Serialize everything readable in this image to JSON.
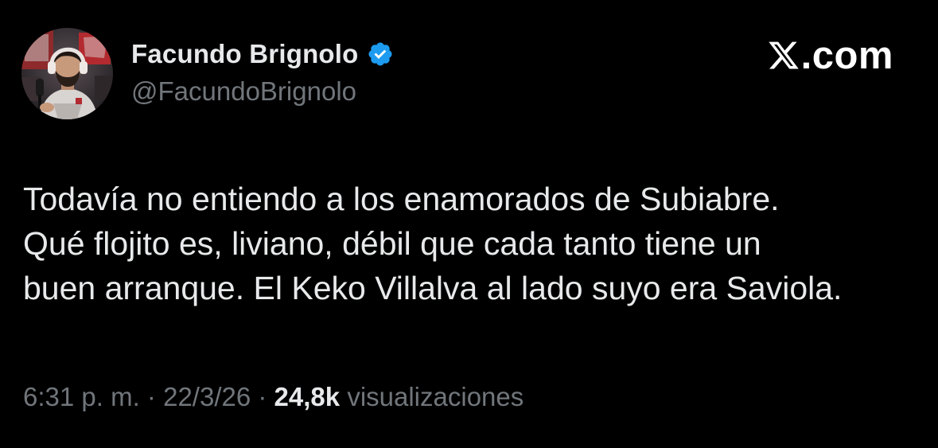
{
  "tweet": {
    "author": {
      "display_name": "Facundo Brignolo",
      "handle": "@FacundoBrignolo",
      "verified": true,
      "verified_color": "#1d9bf0"
    },
    "brand": {
      "text": ".com",
      "logo": "x-logo-icon"
    },
    "body_lines": [
      "Todavía no entiendo a los enamorados de Subiabre.",
      "Qué flojito es, liviano, débil que cada tanto tiene un",
      "buen arranque. El Keko Villalva al lado suyo era Saviola."
    ],
    "meta": {
      "time": "6:31 p. m.",
      "separator": "·",
      "date": "22/3/26",
      "views_count": "24,8k",
      "views_label": "visualizaciones"
    }
  },
  "colors": {
    "background": "#000000",
    "primary_text": "#e7e9ea",
    "secondary_text": "#71767b",
    "accent": "#1d9bf0"
  }
}
